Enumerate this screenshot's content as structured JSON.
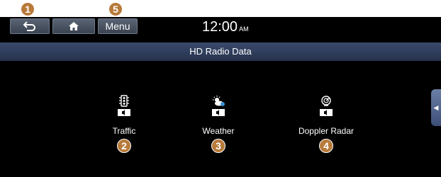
{
  "callouts": [
    "1",
    "2",
    "3",
    "4",
    "5"
  ],
  "toolbar": {
    "menu_label": "Menu"
  },
  "clock": {
    "time": "12:00",
    "ampm": "AM"
  },
  "title": "HD Radio Data",
  "items": [
    {
      "label": "Traffic",
      "icon": "traffic-light-icon"
    },
    {
      "label": "Weather",
      "icon": "weather-icon"
    },
    {
      "label": "Doppler Radar",
      "icon": "doppler-radar-icon"
    }
  ],
  "icons": {
    "back": "back-arrow-icon",
    "home": "home-icon",
    "side_tab": "chevron-left-icon"
  },
  "colors": {
    "callout": "#b87a3a",
    "title_bar": "#2f3d5c",
    "background": "#000000"
  }
}
